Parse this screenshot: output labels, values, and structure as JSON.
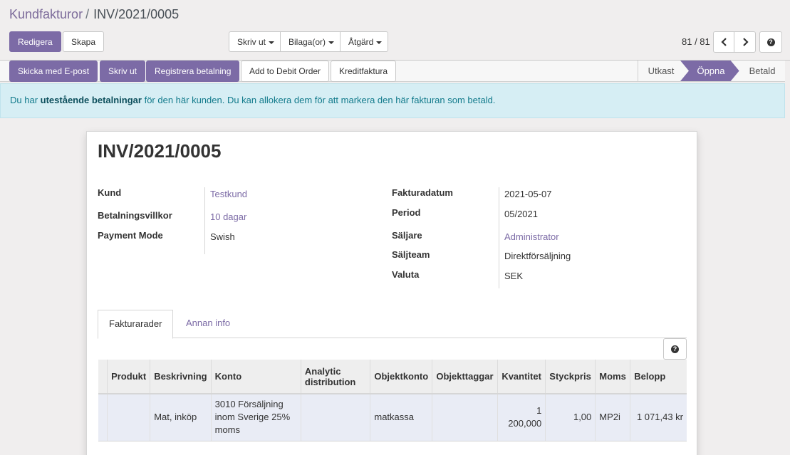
{
  "breadcrumb": {
    "parent": "Kundfakturor",
    "separator": "/",
    "current": "INV/2021/0005"
  },
  "toolbar": {
    "edit": "Redigera",
    "create": "Skapa",
    "print": "Skriv ut",
    "attachments": "Bilaga(or)",
    "action": "Åtgärd"
  },
  "pager": {
    "value": "81 / 81"
  },
  "header_buttons": {
    "send_email": "Skicka med E-post",
    "print": "Skriv ut",
    "register_payment": "Registrera betalning",
    "debit_order": "Add to Debit Order",
    "credit_note": "Kreditfaktura"
  },
  "status": {
    "steps": [
      "Utkast",
      "Öppna",
      "Betald"
    ],
    "active": "Öppna"
  },
  "alert": {
    "prefix": "Du har",
    "bold": "utestående betalningar",
    "suffix": "för den här kunden. Du kan allokera dem för att markera den här fakturan som betald."
  },
  "invoice": {
    "title": "INV/2021/0005",
    "left_fields": {
      "customer_label": "Kund",
      "customer_value": "Testkund",
      "terms_label": "Betalningsvillkor",
      "terms_value": "10 dagar",
      "mode_label": "Payment Mode",
      "mode_value": "Swish"
    },
    "right_fields": {
      "date_label": "Fakturadatum",
      "date_value": "2021-05-07",
      "period_label": "Period",
      "period_value": "05/2021",
      "seller_label": "Säljare",
      "seller_value": "Administrator",
      "team_label": "Säljteam",
      "team_value": "Direktförsäljning",
      "currency_label": "Valuta",
      "currency_value": "SEK"
    }
  },
  "tabs": {
    "lines": "Fakturarader",
    "other": "Annan info"
  },
  "table": {
    "headers": {
      "product": "Produkt",
      "description": "Beskrivning",
      "account": "Konto",
      "analytic": "Analytic distribution",
      "object_account": "Objektkonto",
      "object_tags": "Objekttaggar",
      "quantity": "Kvantitet",
      "unit_price": "Styckpris",
      "tax": "Moms",
      "amount": "Belopp"
    },
    "rows": [
      {
        "product": "",
        "description": "Mat, inköp",
        "account": "3010 Försäljning inom Sverige 25% moms",
        "analytic": "",
        "object_account": "matkassa",
        "object_tags": "",
        "quantity": "1 200,000",
        "unit_price": "1,00",
        "tax": "MP2i",
        "amount": "1 071,43 kr"
      }
    ]
  },
  "icons": {
    "prev": "chevron-left-icon",
    "next": "chevron-right-icon",
    "help": "question-circle-icon"
  },
  "colors": {
    "primary": "#7c6ba6",
    "alert_bg": "#d6eef4",
    "alert_text": "#117a8b"
  }
}
